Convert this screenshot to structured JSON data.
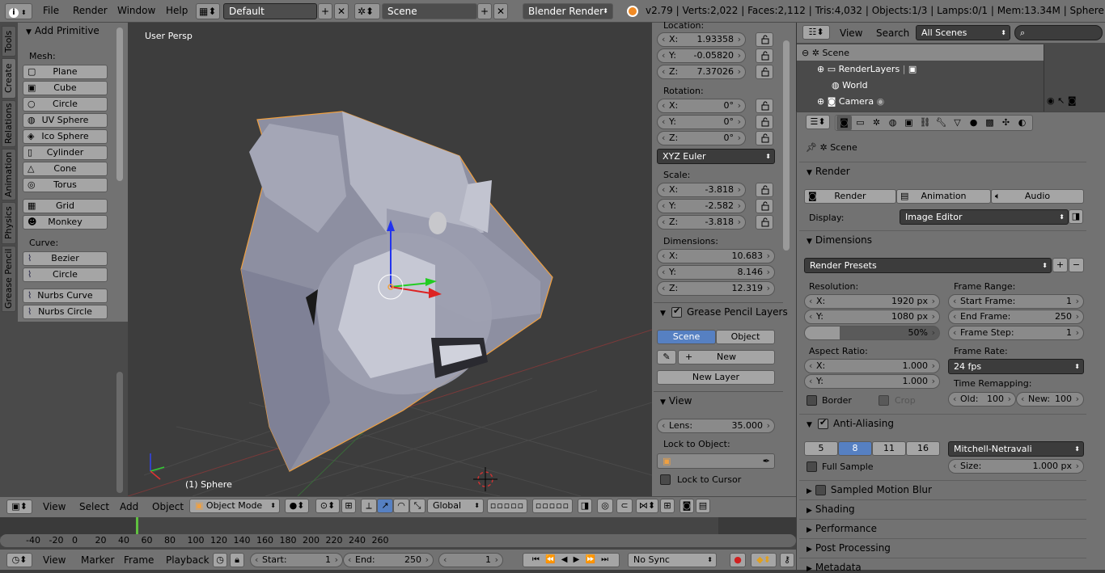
{
  "topbar": {
    "menus": [
      "File",
      "Render",
      "Window",
      "Help"
    ],
    "layout": "Default",
    "scene": "Scene",
    "engine": "Blender Render",
    "stats": "v2.79 | Verts:2,022 | Faces:2,112 | Tris:4,032 | Objects:1/3 | Lamps:0/1 | Mem:13.34M | Sphere"
  },
  "toolshelf": {
    "tabs": [
      "Tools",
      "Create",
      "Relations",
      "Animation",
      "Physics",
      "Grease Pencil"
    ],
    "panel_title": "Add Primitive",
    "mesh_label": "Mesh:",
    "mesh_items": [
      "Plane",
      "Cube",
      "Circle",
      "UV Sphere",
      "Ico Sphere",
      "Cylinder",
      "Cone",
      "Torus"
    ],
    "mesh_items2": [
      "Grid",
      "Monkey"
    ],
    "curve_label": "Curve:",
    "curve_items": [
      "Bezier",
      "Circle"
    ],
    "curve_items2": [
      "Nurbs Curve",
      "Nurbs Circle"
    ]
  },
  "viewport": {
    "view_name": "User Persp",
    "object_name": "(1) Sphere"
  },
  "npanel": {
    "location_label": "Location:",
    "location": [
      {
        "axis": "X:",
        "value": "1.93358"
      },
      {
        "axis": "Y:",
        "value": "-0.05820"
      },
      {
        "axis": "Z:",
        "value": "7.37026"
      }
    ],
    "rotation_label": "Rotation:",
    "rotation": [
      {
        "axis": "X:",
        "value": "0°"
      },
      {
        "axis": "Y:",
        "value": "0°"
      },
      {
        "axis": "Z:",
        "value": "0°"
      }
    ],
    "rotation_mode": "XYZ Euler",
    "scale_label": "Scale:",
    "scale": [
      {
        "axis": "X:",
        "value": "-3.818"
      },
      {
        "axis": "Y:",
        "value": "-2.582"
      },
      {
        "axis": "Z:",
        "value": "-3.818"
      }
    ],
    "dimensions_label": "Dimensions:",
    "dimensions": [
      {
        "axis": "X:",
        "value": "10.683"
      },
      {
        "axis": "Y:",
        "value": "8.146"
      },
      {
        "axis": "Z:",
        "value": "12.319"
      }
    ],
    "gp_title": "Grease Pencil Layers",
    "gp_scene": "Scene",
    "gp_object": "Object",
    "gp_new": "New",
    "gp_new_layer": "New Layer",
    "view_title": "View",
    "lens_label": "Lens:",
    "lens_value": "35.000",
    "lock_label": "Lock to Object:",
    "lock_cursor": "Lock to Cursor"
  },
  "viewheader": {
    "menus": [
      "View",
      "Select",
      "Add",
      "Object"
    ],
    "mode": "Object Mode",
    "orientation": "Global"
  },
  "timeline": {
    "ticks": [
      "-40",
      "-20",
      "0",
      "20",
      "40",
      "60",
      "80",
      "100",
      "120",
      "140",
      "160",
      "180",
      "200",
      "220",
      "240",
      "260"
    ],
    "menus": [
      "View",
      "Marker",
      "Frame",
      "Playback"
    ],
    "start_label": "Start:",
    "start_value": "1",
    "end_label": "End:",
    "end_value": "250",
    "current": "1",
    "sync": "No Sync"
  },
  "outliner": {
    "menus": [
      "View",
      "Search"
    ],
    "filter": "All Scenes",
    "items": [
      "Scene",
      "RenderLayers",
      "World",
      "Camera"
    ]
  },
  "properties": {
    "context": "Scene",
    "render_title": "Render",
    "render_btn": "Render",
    "animation_btn": "Animation",
    "audio_btn": "Audio",
    "display_label": "Display:",
    "display_value": "Image Editor",
    "dimensions_title": "Dimensions",
    "presets": "Render Presets",
    "resolution_label": "Resolution:",
    "res_x_label": "X:",
    "res_x": "1920 px",
    "res_y_label": "Y:",
    "res_y": "1080 px",
    "res_pct": "50%",
    "aspect_label": "Aspect Ratio:",
    "asp_x_label": "X:",
    "asp_x": "1.000",
    "asp_y_label": "Y:",
    "asp_y": "1.000",
    "border": "Border",
    "crop": "Crop",
    "frame_range_label": "Frame Range:",
    "start_frame_label": "Start Frame:",
    "start_frame": "1",
    "end_frame_label": "End Frame:",
    "end_frame": "250",
    "frame_step_label": "Frame Step:",
    "frame_step": "1",
    "frame_rate_label": "Frame Rate:",
    "frame_rate": "24 fps",
    "time_remap_label": "Time Remapping:",
    "old_label": "Old:",
    "old_value": "100",
    "new_label": "New:",
    "new_value": "100",
    "aa_title": "Anti-Aliasing",
    "aa_samples": [
      "5",
      "8",
      "11",
      "16"
    ],
    "aa_filter": "Mitchell-Netravali",
    "full_sample": "Full Sample",
    "size_label": "Size:",
    "size_value": "1.000 px",
    "collapsed": [
      "Sampled Motion Blur",
      "Shading",
      "Performance",
      "Post Processing",
      "Metadata"
    ]
  },
  "colors": {
    "accent": "#5680c2",
    "selected_orange": "#f0a040"
  }
}
